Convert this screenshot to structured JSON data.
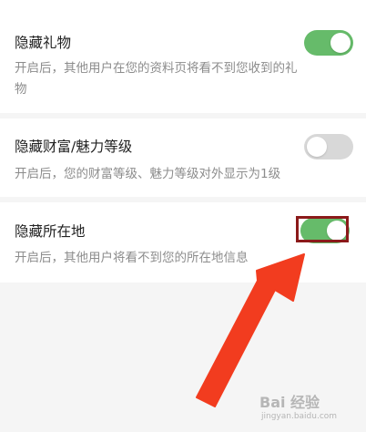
{
  "settings": {
    "items": [
      {
        "title": "隐藏礼物",
        "description": "开启后，其他用户在您的资料页将看不到您收到的礼物",
        "enabled": true
      },
      {
        "title": "隐藏财富/魅力等级",
        "description": "开启后，您的财富等级、魅力等级对外显示为1级",
        "enabled": false
      },
      {
        "title": "隐藏所在地",
        "description": "开启后，其他用户将看不到您的所在地信息",
        "enabled": true
      }
    ]
  },
  "colors": {
    "toggle_on": "#66bb6a",
    "toggle_off": "#d8d8d8",
    "highlight_box": "#8b1a1a",
    "arrow": "#f23c1f"
  },
  "watermark": {
    "logo": "Bai 经验",
    "url": "jingyan.baidu.com"
  }
}
